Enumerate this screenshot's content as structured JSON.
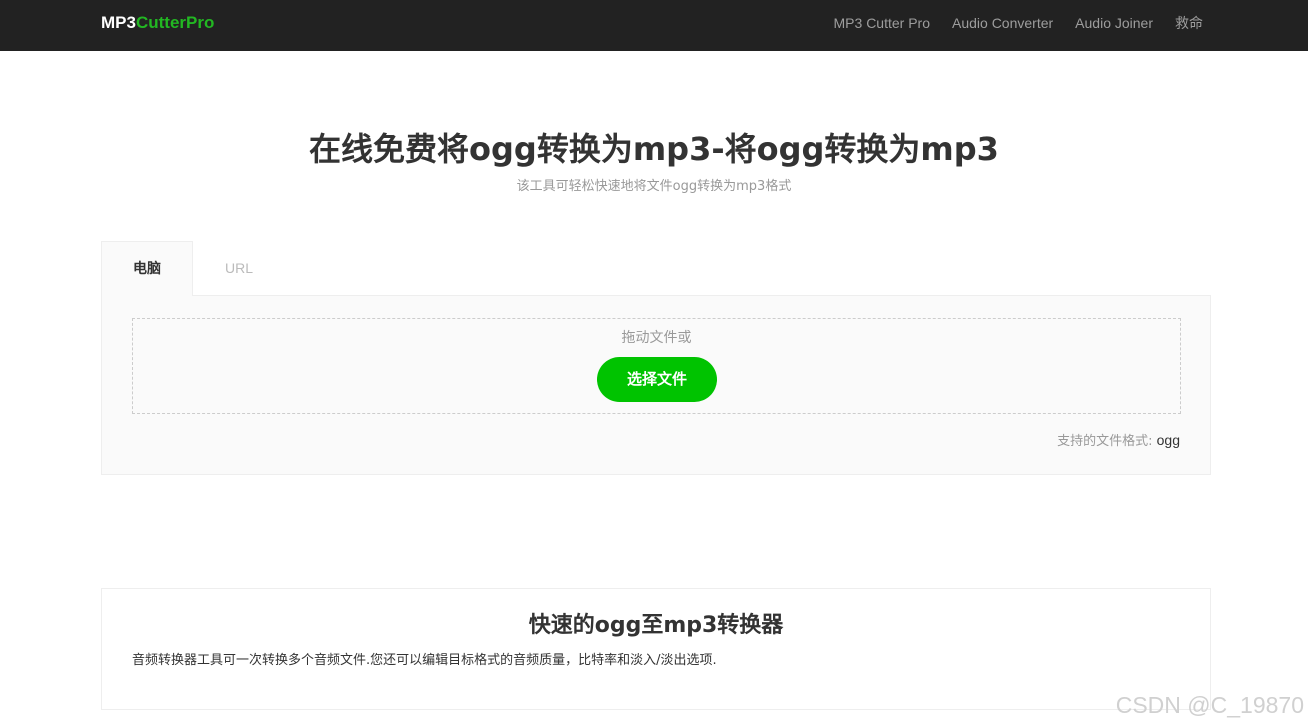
{
  "navbar": {
    "logo_part1": "MP3",
    "logo_part2": "CutterPro",
    "links": [
      "MP3 Cutter Pro",
      "Audio Converter",
      "Audio Joiner",
      "救命"
    ]
  },
  "hero": {
    "title": "在线免费将ogg转换为mp3-将ogg转换为mp3",
    "subtitle": "该工具可轻松快速地将文件ogg转换为mp3格式"
  },
  "upload": {
    "tabs": [
      "电脑",
      "URL"
    ],
    "active_tab": "电脑",
    "drop_label": "拖动文件或",
    "select_button": "选择文件",
    "formats_label": "支持的文件格式:",
    "formats_value": "ogg"
  },
  "feature": {
    "title": "快速的ogg至mp3转换器",
    "description": "音频转换器工具可一次转换多个音频文件.您还可以编辑目标格式的音频质量，比特率和淡入/淡出选项."
  },
  "watermark": "CSDN @C_19870",
  "colors": {
    "navbar_bg": "#222222",
    "brand_green": "#22b722",
    "button_green": "#00c300"
  }
}
